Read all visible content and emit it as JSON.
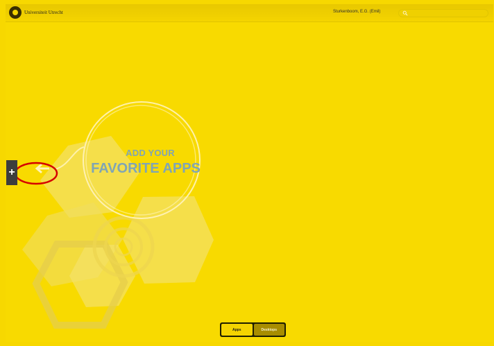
{
  "header": {
    "brand": "Universiteit Utrecht",
    "user": "Sturkenboom, E.G. (Emil)",
    "search_placeholder": ""
  },
  "promo": {
    "line1": "ADD YOUR",
    "line2": "FAVORITE APPS"
  },
  "switcher": {
    "apps_label": "Apps",
    "desktops_label": "Desktops"
  },
  "colors": {
    "background": "#f8da00",
    "accent_text": "#80a5b4",
    "dark_tab": "#3d3d3d",
    "highlight_red": "#d50000"
  }
}
